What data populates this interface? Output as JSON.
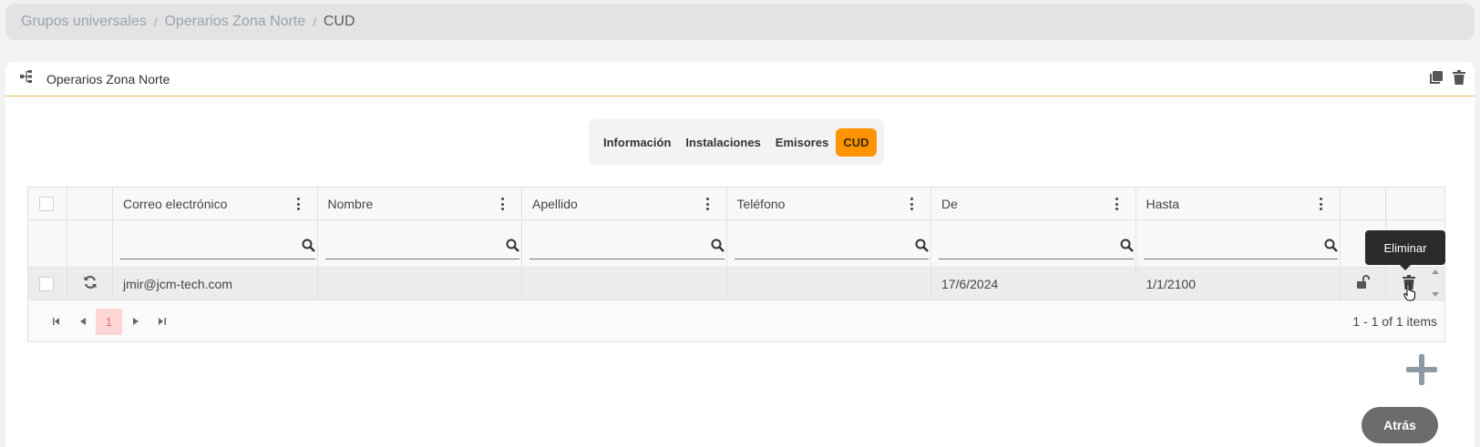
{
  "breadcrumb": {
    "items": [
      "Grupos universales",
      "Operarios Zona Norte"
    ],
    "current": "CUD",
    "separator": "/"
  },
  "card": {
    "title": "Operarios Zona Norte",
    "icons": [
      "hierarchy-icon",
      "copy-icon",
      "trash-icon"
    ]
  },
  "tabs": [
    {
      "label": "Información",
      "active": false
    },
    {
      "label": "Instalaciones",
      "active": false
    },
    {
      "label": "Emisores",
      "active": false
    },
    {
      "label": "CUD",
      "active": true
    }
  ],
  "table": {
    "columns": [
      "Correo electrónico",
      "Nombre",
      "Apellido",
      "Teléfono",
      "De",
      "Hasta"
    ],
    "rows": [
      {
        "email": "jmir@jcm-tech.com",
        "nombre": "",
        "apellido": "",
        "telefono": "",
        "de": "17/6/2024",
        "hasta": "1/1/2100"
      }
    ]
  },
  "pager": {
    "current_page": "1",
    "info": "1 - 1 of 1 items"
  },
  "tooltip": "Eliminar",
  "buttons": {
    "back": "Atrás"
  },
  "colors": {
    "accent": "#ff9400",
    "header_rule": "#e2b94a",
    "back_button": "#6c6c6c"
  }
}
